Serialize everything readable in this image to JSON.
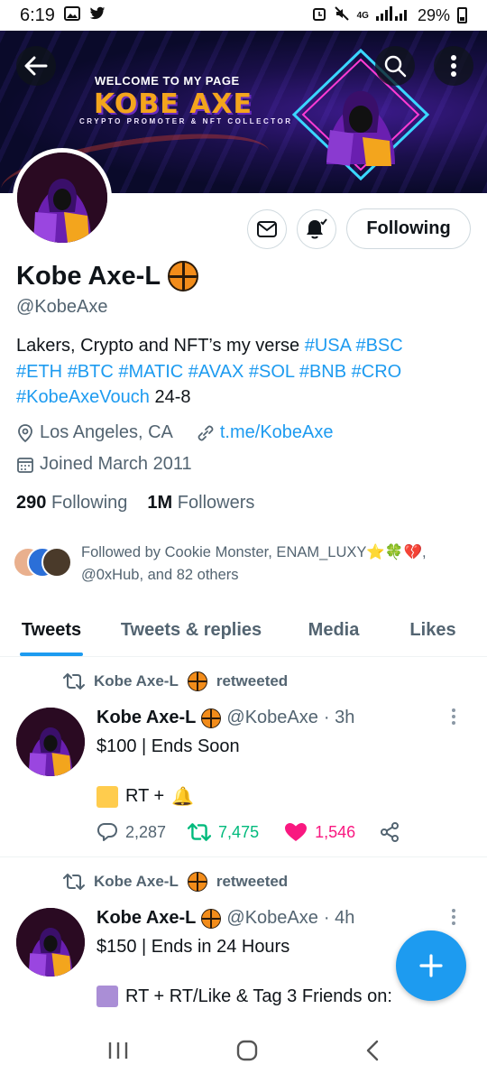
{
  "status_bar": {
    "time": "6:19",
    "network": "4G",
    "battery": "29%",
    "icons": [
      "gallery-icon",
      "twitter-icon",
      "alarm-icon",
      "mute-icon",
      "signal-icon",
      "battery-icon"
    ]
  },
  "banner": {
    "welcome": "WELCOME TO MY PAGE",
    "big_name": "KOBE AXE",
    "tagline": "CRYPTO PROMOTER & NFT COLLECTOR",
    "colors": {
      "accent": "#f3a51d",
      "neon_cyan": "#3ad7ff",
      "neon_pink": "#ff3bd4",
      "bg": "#1a0f4a"
    }
  },
  "profile": {
    "display_name": "Kobe Axe-L",
    "badge_icon": "basketball-emoji",
    "handle": "@KobeAxe",
    "following_button": "Following",
    "bio": {
      "text_plain": "Lakers, Crypto and NFT’s my verse ",
      "tags_line1": [
        "#USA",
        "#BSC"
      ],
      "tags_line2": [
        "#ETH",
        "#BTC",
        "#MATIC",
        "#AVAX",
        "#SOL",
        "#BNB",
        "#CRO"
      ],
      "tag_line3": "#KobeAxeVouch",
      "tail": " 24-8"
    },
    "location": "Los Angeles, CA",
    "website": "t.me/KobeAxe",
    "joined": "Joined March 2011",
    "following_count": "290",
    "following_label": "Following",
    "followers_count": "1M",
    "followers_label": "Followers",
    "followed_by_line1": "Followed by Cookie Monster, ENAM_LUXY",
    "followed_by_emojis": "⭐🍀💔",
    "followed_by_line2": "@0xHub, and 82 others"
  },
  "tabs": [
    {
      "label": "Tweets",
      "active": true
    },
    {
      "label": "Tweets & replies",
      "active": false
    },
    {
      "label": "Media",
      "active": false
    },
    {
      "label": "Likes",
      "active": false
    }
  ],
  "tweets": [
    {
      "retweeted_by": "Kobe Axe-L",
      "retweeted_label": "retweeted",
      "name": "Kobe Axe-L",
      "handle": "@KobeAxe",
      "time": "· 3h",
      "text": "$100 | Ends Soon",
      "line2_text": "RT +",
      "line2_square_color": "#ffcc4d",
      "line2_emoji": "🔔",
      "replies": "2,287",
      "retweets": "7,475",
      "likes": "1,546"
    },
    {
      "retweeted_by": "Kobe Axe-L",
      "retweeted_label": "retweeted",
      "name": "Kobe Axe-L",
      "handle": "@KobeAxe",
      "time": "· 4h",
      "text": "$150 | Ends in 24 Hours",
      "line2_text": "RT + RT/Like & Tag 3 Friends on:",
      "line2_square_color": "#aa8ed6"
    }
  ],
  "colors": {
    "twitter_blue": "#1d9bf0",
    "retweet_green": "#00ba7c",
    "like_pink": "#f91880",
    "muted_text": "#536471"
  }
}
